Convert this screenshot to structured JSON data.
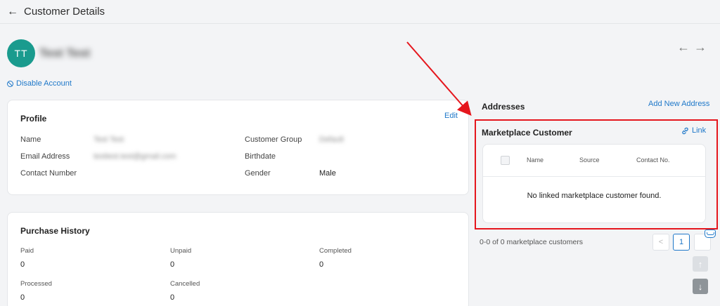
{
  "header": {
    "title": "Customer Details",
    "back_icon": "arrow-left-icon"
  },
  "customer": {
    "initials": "TT",
    "name": "Test Test",
    "avatar_color": "#1a9b8e"
  },
  "nav": {
    "prev_icon": "←",
    "next_icon": "→"
  },
  "disable_account_label": "Disable Account",
  "profile": {
    "title": "Profile",
    "edit_label": "Edit",
    "fields": {
      "name_label": "Name",
      "name_value": "Test Test",
      "email_label": "Email Address",
      "email_value": "testtest.test@gmail.com",
      "contact_label": "Contact Number",
      "group_label": "Customer Group",
      "group_value": "Default",
      "birthdate_label": "Birthdate",
      "gender_label": "Gender",
      "gender_value": "Male"
    }
  },
  "purchase_history": {
    "title": "Purchase History",
    "paid_label": "Paid",
    "paid_value": "0",
    "unpaid_label": "Unpaid",
    "unpaid_value": "0",
    "completed_label": "Completed",
    "completed_value": "0",
    "processed_label": "Processed",
    "processed_value": "0",
    "cancelled_label": "Cancelled",
    "cancelled_value": "0"
  },
  "addresses": {
    "title": "Addresses",
    "add_label": "Add New Address"
  },
  "marketplace": {
    "title": "Marketplace Customer",
    "link_label": "Link",
    "columns": {
      "name": "Name",
      "source": "Source",
      "contact": "Contact No."
    },
    "empty_message": "No linked marketplace customer found.",
    "summary": "0-0 of 0 marketplace customers",
    "current_page": "1",
    "pager_prev": "<",
    "pager_next": ">"
  },
  "scroll": {
    "up": "↑",
    "down": "↓"
  },
  "colors": {
    "accent": "#1f78c9",
    "highlight": "#e5161d"
  }
}
